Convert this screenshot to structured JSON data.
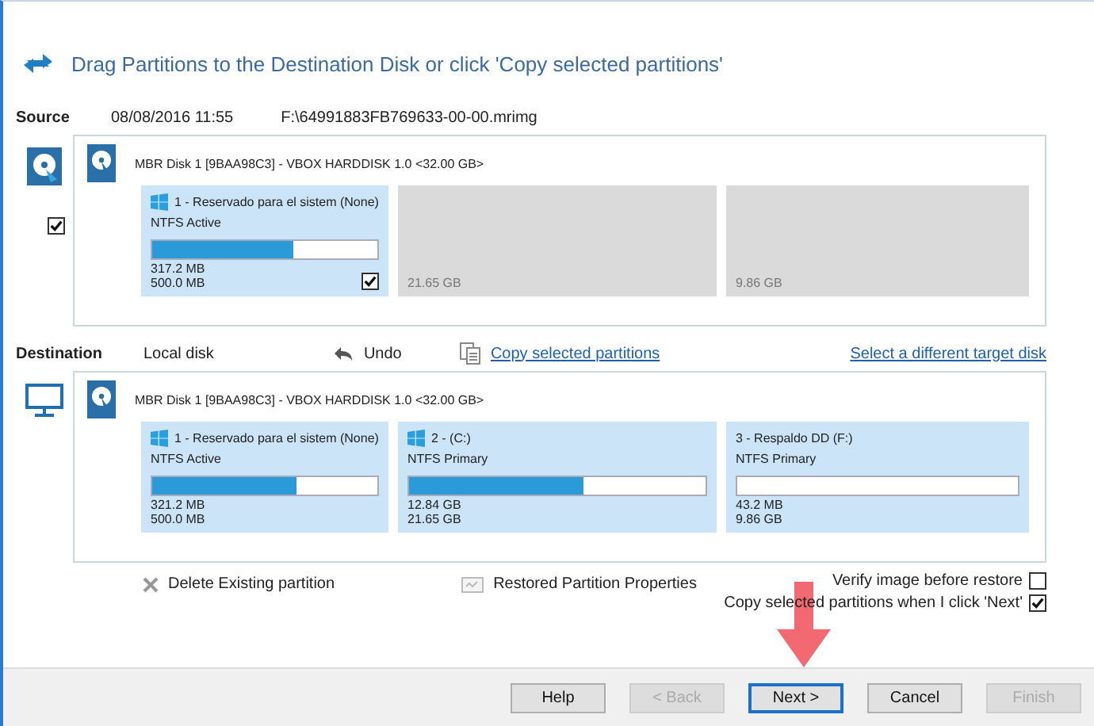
{
  "header": {
    "title": "Drag Partitions to the Destination Disk or click 'Copy selected partitions'"
  },
  "source": {
    "label": "Source",
    "date": "08/08/2016 11:55",
    "file": "F:\\64991883FB769633-00-00.mrimg",
    "disk_checked": true,
    "disk": {
      "title": "MBR Disk 1 [9BAA98C3] - VBOX HARDDISK 1.0  <32.00 GB>",
      "partitions": [
        {
          "kind": "partition",
          "title": "1 - Reservado para el sistem (None)",
          "os_icon": true,
          "fs": "NTFS Active",
          "level": 0.63,
          "used": "317.2 MB",
          "total": "500.0 MB",
          "checked": true
        },
        {
          "kind": "unallocated",
          "size": "21.65 GB"
        },
        {
          "kind": "unallocated",
          "size": "9.86 GB"
        }
      ]
    }
  },
  "destination": {
    "label": "Destination",
    "target": "Local disk",
    "undo": "Undo",
    "copy_link": "Copy selected partitions",
    "select_link": "Select a different target disk",
    "disk": {
      "title": "MBR Disk 1 [9BAA98C3] - VBOX HARDDISK 1.0  <32.00 GB>",
      "partitions": [
        {
          "kind": "partition",
          "title": "1 - Reservado para el sistem (None)",
          "os_icon": true,
          "fs": "NTFS Active",
          "level": 0.64,
          "used": "321.2 MB",
          "total": "500.0 MB"
        },
        {
          "kind": "partition",
          "title": "2 -  (C:)",
          "os_icon": true,
          "fs": "NTFS Primary",
          "level": 0.59,
          "used": "12.84 GB",
          "total": "21.65 GB"
        },
        {
          "kind": "partition",
          "title": "3 - Respaldo DD (F:)",
          "os_icon": false,
          "fs": "NTFS Primary",
          "level": 0.0,
          "used": "43.2 MB",
          "total": "9.86 GB"
        }
      ]
    }
  },
  "actions": [
    {
      "label": "Delete Existing partition",
      "kind": "delete"
    },
    {
      "label": "Restored Partition Properties",
      "kind": "properties"
    }
  ],
  "options": [
    {
      "label": "Verify image before restore",
      "checked": false
    },
    {
      "label": "Copy selected partitions when I click 'Next'",
      "checked": true
    }
  ],
  "buttons": [
    {
      "label": "Help",
      "disabled": false,
      "default": false
    },
    {
      "label": "< Back",
      "disabled": true,
      "default": false
    },
    {
      "label": "Next >",
      "disabled": false,
      "default": true
    },
    {
      "label": "Cancel",
      "disabled": false,
      "default": false
    },
    {
      "label": "Finish",
      "disabled": true,
      "default": false
    }
  ]
}
